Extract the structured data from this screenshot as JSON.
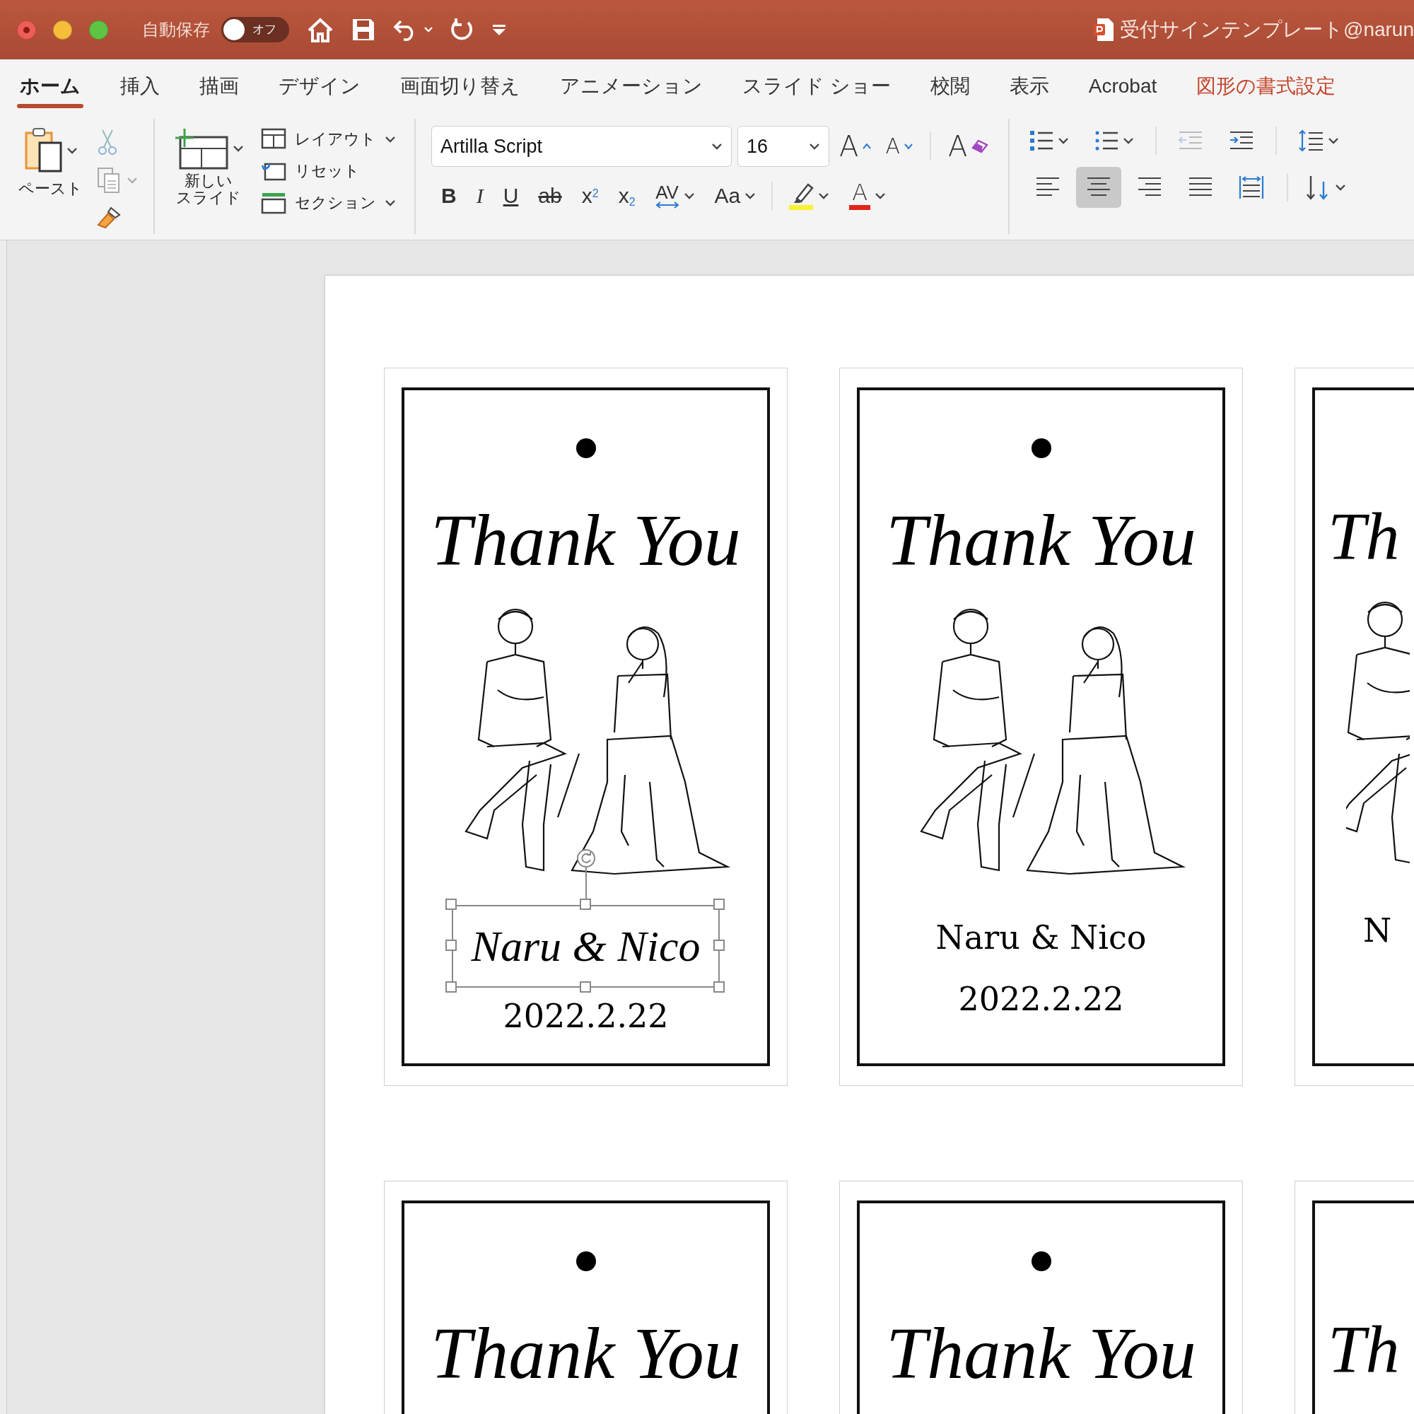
{
  "window": {
    "title": "受付サインテンプレート@narun",
    "autosave": {
      "label": "自動保存",
      "toggle_text": "オフ",
      "on": false
    }
  },
  "tabs": [
    {
      "label": "ホーム",
      "selected": true,
      "kind": "normal"
    },
    {
      "label": "挿入",
      "selected": false,
      "kind": "normal"
    },
    {
      "label": "描画",
      "selected": false,
      "kind": "normal"
    },
    {
      "label": "デザイン",
      "selected": false,
      "kind": "normal"
    },
    {
      "label": "画面切り替え",
      "selected": false,
      "kind": "normal"
    },
    {
      "label": "アニメーション",
      "selected": false,
      "kind": "normal"
    },
    {
      "label": "スライド ショー",
      "selected": false,
      "kind": "normal"
    },
    {
      "label": "校閲",
      "selected": false,
      "kind": "normal"
    },
    {
      "label": "表示",
      "selected": false,
      "kind": "normal"
    },
    {
      "label": "Acrobat",
      "selected": false,
      "kind": "normal"
    },
    {
      "label": "図形の書式設定",
      "selected": false,
      "kind": "contextual"
    }
  ],
  "ribbon": {
    "clipboard": {
      "paste_label": "ペースト"
    },
    "slides": {
      "new_slide_label_lines": [
        "新しい",
        "スライド"
      ],
      "commands": [
        {
          "label": "レイアウト",
          "kind": "layout",
          "dropdown": true
        },
        {
          "label": "リセット",
          "kind": "reset",
          "dropdown": false
        },
        {
          "label": "セクション",
          "kind": "section",
          "dropdown": true
        }
      ]
    },
    "font": {
      "name": "Artilla Script",
      "size": "16",
      "grow_label": "A",
      "shrink_label": "A",
      "clear_label": "A",
      "font_color_label": "A",
      "format_buttons": [
        {
          "label": "B",
          "kind": "bold",
          "dropdown": false
        },
        {
          "label": "I",
          "kind": "italic",
          "dropdown": false
        },
        {
          "label": "U",
          "kind": "underline",
          "dropdown": false
        },
        {
          "label": "ab",
          "kind": "strike",
          "dropdown": false
        },
        {
          "label": "x$^{2}$",
          "kind": "plain",
          "dropdown": false
        },
        {
          "label": "x$_{2}$",
          "kind": "plain",
          "dropdown": false
        },
        {
          "label": "AV",
          "kind": "spacing",
          "dropdown": true
        },
        {
          "label": "Aa",
          "kind": "plain",
          "dropdown": true
        }
      ]
    },
    "paragraph": {
      "indents": [
        {
          "kind": "outdent",
          "disabled": true
        },
        {
          "kind": "indent",
          "disabled": false
        }
      ],
      "alignments": [
        {
          "kind": "left",
          "selected": false
        },
        {
          "kind": "center",
          "selected": true
        },
        {
          "kind": "right",
          "selected": false
        },
        {
          "kind": "justify",
          "selected": false
        },
        {
          "kind": "distribute",
          "selected": false
        }
      ]
    }
  },
  "slide": {
    "cards": [
      {
        "thank_you": "Thank You",
        "illustration": true,
        "names": {
          "text": "Naru & Nico",
          "kind": "script"
        },
        "date": "2022.2.22",
        "selected": true,
        "cut": false
      },
      {
        "thank_you": "Thank You",
        "illustration": true,
        "names": {
          "text": "Naru & Nico",
          "kind": "serif"
        },
        "date": "2022.2.22",
        "selected": false,
        "cut": false
      },
      {
        "thank_you": "Th",
        "illustration": true,
        "names": {
          "text": "N",
          "kind": "serif"
        },
        "selected": false,
        "cut": true
      },
      {
        "thank_you": "Thank You",
        "illustration": false,
        "selected": false,
        "cut": false
      },
      {
        "thank_you": "Thank You",
        "illustration": false,
        "selected": false,
        "cut": false
      },
      {
        "thank_you": "Th",
        "illustration": false,
        "selected": false,
        "cut": true
      }
    ]
  }
}
